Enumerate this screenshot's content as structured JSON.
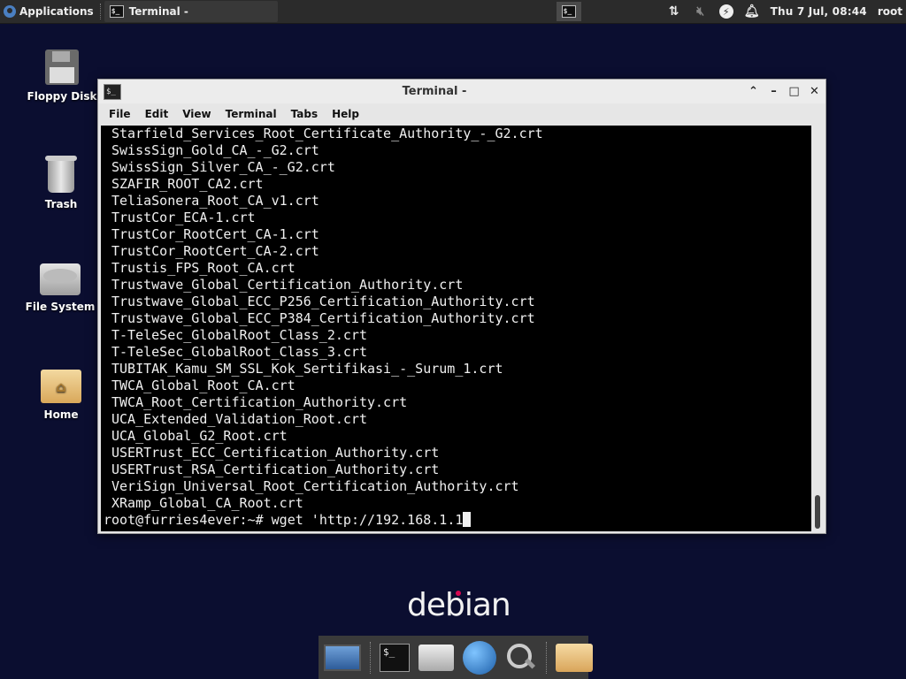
{
  "top_panel": {
    "apps_label": "Applications",
    "task_title": "Terminal -",
    "clock": "Thu 7 Jul, 08:44",
    "user": "root"
  },
  "desktop_icons": [
    {
      "label": "Floppy Disk",
      "icon": "floppy-icon"
    },
    {
      "label": "Trash",
      "icon": "trash-icon"
    },
    {
      "label": "File System",
      "icon": "harddrive-icon"
    },
    {
      "label": "Home",
      "icon": "home-folder-icon"
    }
  ],
  "terminal": {
    "title": "Terminal -",
    "menu": [
      "File",
      "Edit",
      "View",
      "Terminal",
      "Tabs",
      "Help"
    ],
    "lines": [
      "Starfield_Services_Root_Certificate_Authority_-_G2.crt",
      "SwissSign_Gold_CA_-_G2.crt",
      "SwissSign_Silver_CA_-_G2.crt",
      "SZAFIR_ROOT_CA2.crt",
      "TeliaSonera_Root_CA_v1.crt",
      "TrustCor_ECA-1.crt",
      "TrustCor_RootCert_CA-1.crt",
      "TrustCor_RootCert_CA-2.crt",
      "Trustis_FPS_Root_CA.crt",
      "Trustwave_Global_Certification_Authority.crt",
      "Trustwave_Global_ECC_P256_Certification_Authority.crt",
      "Trustwave_Global_ECC_P384_Certification_Authority.crt",
      "T-TeleSec_GlobalRoot_Class_2.crt",
      "T-TeleSec_GlobalRoot_Class_3.crt",
      "TUBITAK_Kamu_SM_SSL_Kok_Sertifikasi_-_Surum_1.crt",
      "TWCA_Global_Root_CA.crt",
      "TWCA_Root_Certification_Authority.crt",
      "UCA_Extended_Validation_Root.crt",
      "UCA_Global_G2_Root.crt",
      "USERTrust_ECC_Certification_Authority.crt",
      "USERTrust_RSA_Certification_Authority.crt",
      "VeriSign_Universal_Root_Certification_Authority.crt",
      "XRamp_Global_CA_Root.crt"
    ],
    "prompt": "root@furries4ever:~# wget 'http://192.168.1.1"
  },
  "branding": {
    "logo_text": "debian",
    "accent_color": "#d70751"
  },
  "dock_items": [
    "desktop-icon",
    "terminal-icon",
    "file-manager-icon",
    "web-browser-icon",
    "search-icon",
    "folder-icon"
  ]
}
